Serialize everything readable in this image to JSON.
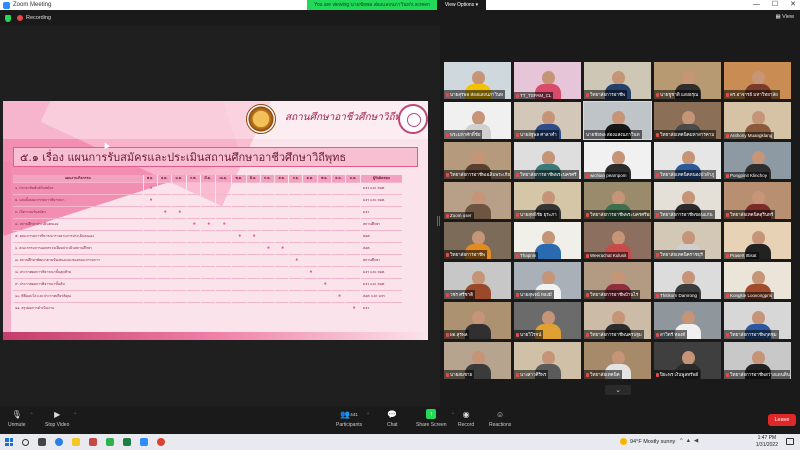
{
  "window": {
    "title": "Zoom Meeting",
    "controls": [
      "—",
      "☐",
      "✕"
    ]
  },
  "banner": {
    "message": "You are viewing นายชัยพล ส่องแสงนภาวินท's screen",
    "view_options": "View Options ▾"
  },
  "status": {
    "recording": "Recording",
    "view": "View"
  },
  "slide": {
    "org_name": "สถานศึกษาอาชีวศึกษาวิถีพุทธ",
    "title": "๕.๑ เรื่อง แผนการรับสมัครและประเมินสถานศึกษาอาชีวศึกษาวิถีพุทธ",
    "header_activity": "แผนงาน/กิจกรรม",
    "header_owner": "ผู้รับผิดชอบ",
    "months": [
      "พ.ย.",
      "ธ.ค.",
      "ม.ค.",
      "ก.พ.",
      "มี.ค.",
      "เม.ย.",
      "พ.ค.",
      "มิ.ย.",
      "ก.ค.",
      "ส.ค.",
      "ก.ย.",
      "ต.ค.",
      "พ.ย.",
      "ธ.ค.",
      "ม.ค."
    ],
    "rows": [
      {
        "activity": "๑. ประชาสัมพันธ์รับสมัคร",
        "owner": "มจร และ สอศ.",
        "marks": [
          0
        ]
      },
      {
        "activity": "๒. แต่งตั้งคณะกรรมการพิจารณา",
        "owner": "มจร และ สอศ.",
        "marks": [
          0
        ]
      },
      {
        "activity": "๓. เปิดระบบรับสมัคร",
        "owner": "มจร",
        "marks": [
          1,
          2
        ]
      },
      {
        "activity": "๔. สถานศึกษาประเมินตนเอง",
        "owner": "สถานศึกษา",
        "marks": [
          3,
          4,
          5
        ]
      },
      {
        "activity": "๕. คณะกรรมการพิจารณารายงานการประเมินตนเอง",
        "owner": "สอศ.",
        "marks": [
          6,
          7
        ]
      },
      {
        "activity": "๖. คณะกรรมการออกตรวจเยี่ยมประเมินสถานศึกษา",
        "owner": "สอศ.",
        "marks": [
          8,
          9
        ]
      },
      {
        "activity": "๗. สถานศึกษาพัฒนาตามข้อเสนอแนะของคณะกรรมการ",
        "owner": "สถานศึกษา",
        "marks": [
          10
        ]
      },
      {
        "activity": "๘. ประกาศผลการพิจารณาขั้นสุดท้าย",
        "owner": "มจร และ สอศ.",
        "marks": [
          11
        ]
      },
      {
        "activity": "๙. ประกาศผลการพิจารณาขั้นต้น",
        "owner": "มจร และ สอศ.",
        "marks": [
          12
        ]
      },
      {
        "activity": "๑๐. พิธีมอบโล่ และประกาศเกียรติคุณ",
        "owner": "สอศ. และ มจร",
        "marks": [
          13
        ]
      },
      {
        "activity": "๑๑. สรุปผลการดำเนินงาน",
        "owner": "มจร",
        "marks": [
          14
        ]
      }
    ]
  },
  "participants": [
    {
      "name": "นายสุรพล ส่องแสงนภาวินท",
      "muted": true,
      "shirt": "#f2c200",
      "bg": "#cfd8dc"
    },
    {
      "name": "TT_TSPAM_CL",
      "muted": true,
      "shirt": "#d94b6a",
      "bg": "#e7c5d8"
    },
    {
      "name": "วิทยาลัยการอาชีพ",
      "muted": true,
      "shirt": "#24406b",
      "bg": "#cfc7b5"
    },
    {
      "name": "นายชูชาติ แสงอรุณ",
      "muted": true,
      "shirt": "#2e2e2e",
      "bg": "#b79a72"
    },
    {
      "name": "ดร.อาจารย์ มหาวิทยาลัย",
      "muted": true,
      "shirt": "#7a3c2a",
      "bg": "#c98d53"
    },
    {
      "name": "พระมหาศักดิ์ชัย",
      "muted": true,
      "shirt": "#d0d0d0",
      "bg": "#f0f0f0"
    },
    {
      "name": "นายอัฐพล ศาลาคำ",
      "muted": true,
      "shirt": "#2c4d8a",
      "bg": "#d2c7b8"
    },
    {
      "name": "นายชัยพล ส่องแสงนภาวินท",
      "muted": false,
      "shirt": "#181818",
      "bg": "#bfc4c9"
    },
    {
      "name": "วิทยาลัยเทคนิคมหาสารคาม",
      "muted": true,
      "shirt": "#4a4a4a",
      "bg": "#8b6f56"
    },
    {
      "name": "Anthony Muangklang",
      "muted": true,
      "shirt": "#8a5b3a",
      "bg": "#d6c2a4"
    },
    {
      "name": "วิทยาลัยการอาชีพเฉลิมพระเกียรติ",
      "muted": true,
      "shirt": "#5b3f2f",
      "bg": "#b59a7d"
    },
    {
      "name": "วิทยาลัยการอาชีพพระนครศรี",
      "muted": true,
      "shirt": "#3a7a7a",
      "bg": "#dedede"
    },
    {
      "name": "wichian pearnpom",
      "muted": true,
      "shirt": "#2c2c2c",
      "bg": "#f1f1f1"
    },
    {
      "name": "วิทยาลัยเทคนิคหนองบัวลำภู",
      "muted": true,
      "shirt": "#2a5a9a",
      "bg": "#e6e6e6"
    },
    {
      "name": "Pongpinit Klinchoy",
      "muted": true,
      "shirt": "#2e2e2e",
      "bg": "#8d9aa3"
    },
    {
      "name": "Zoom user",
      "muted": true,
      "shirt": "#6e5541",
      "bg": "#b8a088"
    },
    {
      "name": "นายสุทธิชัย ยุระภา",
      "muted": true,
      "shirt": "#353535",
      "bg": "#d5c6a8"
    },
    {
      "name": "วิทยาลัยการอาชีพพระนครศรีอยุธยา",
      "muted": true,
      "shirt": "#3e6f4c",
      "bg": "#9a8b6c"
    },
    {
      "name": "วิทยาลัยการอาชีพขอนแก่น",
      "muted": true,
      "shirt": "#2b2b2b",
      "bg": "#e4e0d8"
    },
    {
      "name": "วิทยาลัยเทคนิคสุรินทร์",
      "muted": true,
      "shirt": "#7a2a2a",
      "bg": "#b98f71"
    },
    {
      "name": "วิทยาลัยการอาชีพ",
      "muted": true,
      "shirt": "#e28b20",
      "bg": "#7d6b5a"
    },
    {
      "name": "Thapnin",
      "muted": true,
      "shirt": "#2a6ab0",
      "bg": "#f0efe9"
    },
    {
      "name": "Weerachat Kulusit",
      "muted": true,
      "shirt": "#c74b4b",
      "bg": "#8c6f5e"
    },
    {
      "name": "วิทยาลัยเทคนิคราชบุรี",
      "muted": true,
      "shirt": "#cfcfcf",
      "bg": "#d3c7b6"
    },
    {
      "name": "Prasert Ittisat",
      "muted": true,
      "shirt": "#222",
      "bg": "#e7d2b6"
    },
    {
      "name": "วชร ศรีชาติ",
      "muted": true,
      "shirt": "#9a4a2a",
      "bg": "#c7c7c7"
    },
    {
      "name": "นายสุพจน์ ทองมี",
      "muted": true,
      "shirt": "#f2f2f2",
      "bg": "#a9b0b7"
    },
    {
      "name": "วิทยาลัยการอาชีพบ้านไร่",
      "muted": true,
      "shirt": "#8f2f3c",
      "bg": "#b29b82"
    },
    {
      "name": "Thitikorn Damrong",
      "muted": true,
      "shirt": "#3c3c3c",
      "bg": "#dcdcdc"
    },
    {
      "name": "Kongkie Loovongpris",
      "muted": true,
      "shirt": "#a14c2c",
      "bg": "#ebe4d8"
    },
    {
      "name": "ผอ.สุรพล",
      "muted": true,
      "shirt": "#303030",
      "bg": "#ad9272"
    },
    {
      "name": "นายวิโรจน์",
      "muted": true,
      "shirt": "#e0a032",
      "bg": "#6b6b6b"
    },
    {
      "name": "วิทยาลัยการอาชีพนครปฐม",
      "muted": true,
      "shirt": "#2d2d2d",
      "bg": "#cbbba7"
    },
    {
      "name": "สาวิตรี ทองดี",
      "muted": true,
      "shirt": "#f0f0f0",
      "bg": "#8f969c"
    },
    {
      "name": "วิทยาลัยการอาชีพกุดชุม",
      "muted": true,
      "shirt": "#2c58a0",
      "bg": "#d7d7d7"
    },
    {
      "name": "นายสมชาย",
      "muted": true,
      "shirt": "#3b3b3b",
      "bg": "#b6a48f"
    },
    {
      "name": "นางสาวศิริพร",
      "muted": true,
      "shirt": "#5a5a5a",
      "bg": "#d0c0a8"
    },
    {
      "name": "วิทยาลัยเทคนิค",
      "muted": true,
      "shirt": "#e3e3e3",
      "bg": "#a68a6a"
    },
    {
      "name": "ปิยะพร เงินพูลทรัพย์",
      "muted": true,
      "shirt": "#2b2b2b",
      "bg": "#3f3f3f"
    },
    {
      "name": "วิทยาลัยการอาชีพสว่างแดนดิน",
      "muted": true,
      "shirt": "#222",
      "bg": "#c8c8c8"
    }
  ],
  "toolbar": {
    "unmute": "Unmute",
    "stop_video": "Stop Video",
    "participants": "Participants",
    "participant_count": "441",
    "chat": "Chat",
    "share_screen": "Share Screen",
    "record": "Record",
    "reactions": "Reactions",
    "leave": "Leave"
  },
  "taskbar": {
    "weather": "94°F  Mostly sunny",
    "time": "1:47 PM",
    "date": "1/31/2022"
  },
  "colors": {
    "accent_green": "#23d959",
    "leave_red": "#e02828",
    "slide_pink": "#f07fa8"
  }
}
